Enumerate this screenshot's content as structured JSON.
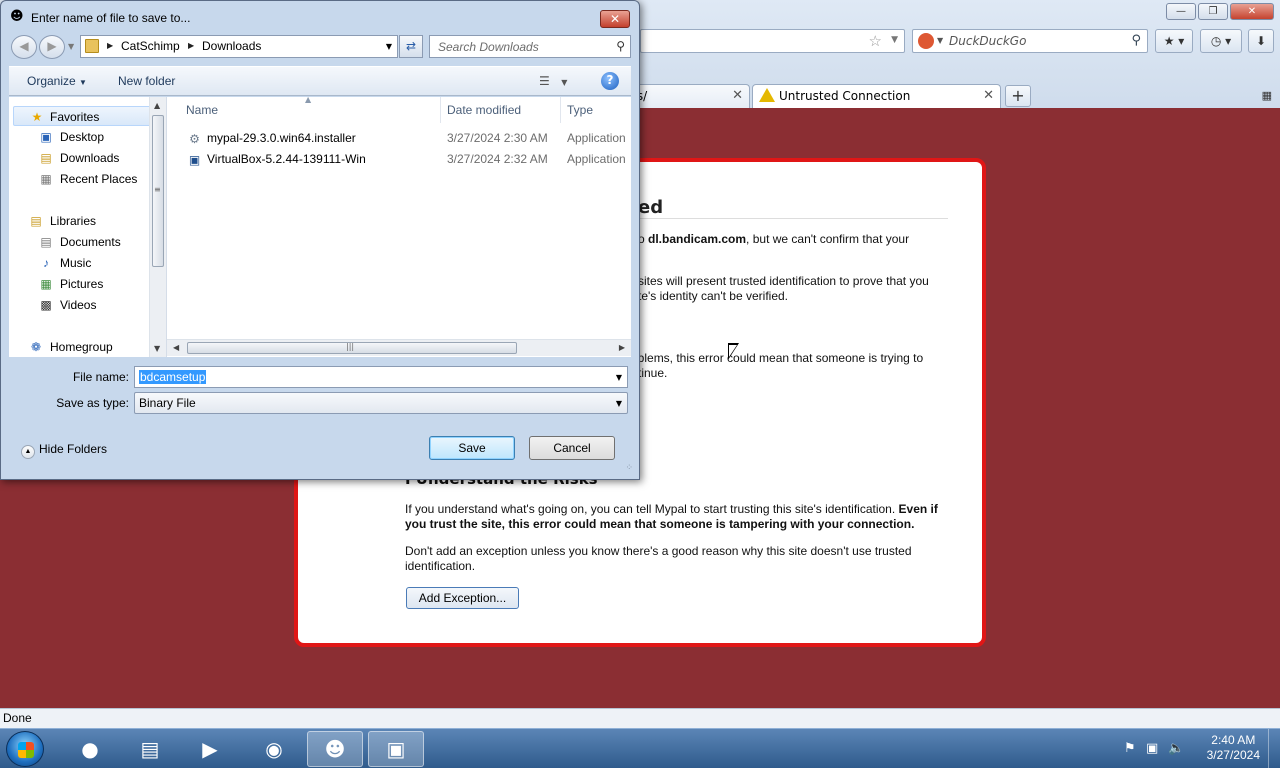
{
  "browser": {
    "search_placeholder": "DuckDuckGo",
    "tabs": [
      {
        "label": "ws/"
      },
      {
        "label": "Untrusted Connection"
      }
    ],
    "new_tab": "+",
    "status": "Done"
  },
  "error_page": {
    "title_fragment": "ed",
    "line1": "o dl.bandicam.com, but we can't confirm that your",
    "line1_bold": "dl.bandicam.com",
    "line2": "sites will present trusted identification to prove that you",
    "line3": "te's identity can't be verified.",
    "line4": "oblems, this error could mean that someone is trying to",
    "line5": "tinue.",
    "risks_heading": "I Understand the Risks",
    "risks_p1": "If you understand what's going on, you can tell Mypal to start trusting this site's identification.",
    "risks_p1_bold": "Even if you trust the site, this error could mean that someone is tampering with your connection.",
    "risks_p2": "Don't add an exception unless you know there's a good reason why this site doesn't use trusted identification.",
    "add_exception": "Add Exception..."
  },
  "dialog": {
    "title": "Enter name of file to save to...",
    "breadcrumb": [
      "CatSchimp",
      "Downloads"
    ],
    "search_placeholder": "Search Downloads",
    "toolbar": {
      "organize": "Organize",
      "new_folder": "New folder"
    },
    "nav": {
      "favorites": "Favorites",
      "desktop": "Desktop",
      "downloads": "Downloads",
      "recent": "Recent Places",
      "libraries": "Libraries",
      "documents": "Documents",
      "music": "Music",
      "pictures": "Pictures",
      "videos": "Videos",
      "homegroup": "Homegroup"
    },
    "columns": {
      "name": "Name",
      "date": "Date modified",
      "type": "Type"
    },
    "files": [
      {
        "name": "mypal-29.3.0.win64.installer",
        "date": "3/27/2024 2:30 AM",
        "type": "Application"
      },
      {
        "name": "VirtualBox-5.2.44-139111-Win",
        "date": "3/27/2024 2:32 AM",
        "type": "Application"
      }
    ],
    "file_name_label": "File name:",
    "file_name_value": "bdcamsetup",
    "save_as_label": "Save as type:",
    "save_as_value": "Binary File",
    "hide_folders": "Hide Folders",
    "save": "Save",
    "cancel": "Cancel"
  },
  "taskbar": {
    "time": "2:40 AM",
    "date": "3/27/2024"
  }
}
